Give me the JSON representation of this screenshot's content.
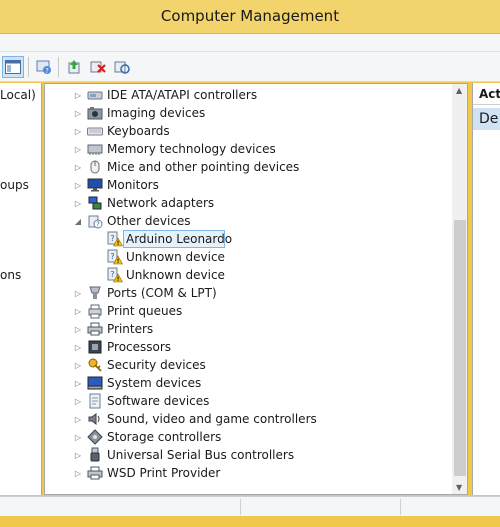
{
  "window": {
    "title": "Computer Management"
  },
  "left_tree_fragments": [
    "Local)",
    "oups",
    "ons"
  ],
  "actions": {
    "header": "Acti",
    "item": "De"
  },
  "toolbar": {
    "buttons": [
      "show-hide-console-tree-icon",
      "help-icon",
      "update-driver-icon",
      "uninstall-device-icon",
      "scan-hardware-icon"
    ]
  },
  "device_tree": [
    {
      "label": "IDE ATA/ATAPI controllers",
      "icon": "ide-controller-icon",
      "expanded": false
    },
    {
      "label": "Imaging devices",
      "icon": "imaging-device-icon",
      "expanded": false
    },
    {
      "label": "Keyboards",
      "icon": "keyboard-icon",
      "expanded": false
    },
    {
      "label": "Memory technology devices",
      "icon": "memory-device-icon",
      "expanded": false
    },
    {
      "label": "Mice and other pointing devices",
      "icon": "mouse-icon",
      "expanded": false
    },
    {
      "label": "Monitors",
      "icon": "monitor-icon",
      "expanded": false
    },
    {
      "label": "Network adapters",
      "icon": "network-adapter-icon",
      "expanded": false
    },
    {
      "label": "Other devices",
      "icon": "other-devices-icon",
      "expanded": true,
      "children": [
        {
          "label": "Arduino Leonardo",
          "icon": "unknown-device-warning-icon",
          "selected": true
        },
        {
          "label": "Unknown device",
          "icon": "unknown-device-warning-icon"
        },
        {
          "label": "Unknown device",
          "icon": "unknown-device-warning-icon"
        }
      ]
    },
    {
      "label": "Ports (COM & LPT)",
      "icon": "port-icon",
      "expanded": false
    },
    {
      "label": "Print queues",
      "icon": "print-queue-icon",
      "expanded": false
    },
    {
      "label": "Printers",
      "icon": "printer-icon",
      "expanded": false
    },
    {
      "label": "Processors",
      "icon": "processor-icon",
      "expanded": false
    },
    {
      "label": "Security devices",
      "icon": "security-device-icon",
      "expanded": false
    },
    {
      "label": "System devices",
      "icon": "system-device-icon",
      "expanded": false
    },
    {
      "label": "Software devices",
      "icon": "software-device-icon",
      "expanded": false
    },
    {
      "label": "Sound, video and game controllers",
      "icon": "sound-icon",
      "expanded": false
    },
    {
      "label": "Storage controllers",
      "icon": "storage-controller-icon",
      "expanded": false
    },
    {
      "label": "Universal Serial Bus controllers",
      "icon": "usb-icon",
      "expanded": false
    },
    {
      "label": "WSD Print Provider",
      "icon": "wsd-print-icon",
      "expanded": false
    }
  ],
  "colors": {
    "title_bar": "#f3d36b",
    "selection": "#e5f1fb",
    "selection_border": "#7fb6e6",
    "warning": "#f2c200"
  }
}
